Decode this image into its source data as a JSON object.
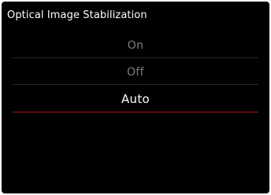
{
  "header": {
    "title": "Optical Image Stabilization"
  },
  "options": [
    {
      "label": "On"
    },
    {
      "label": "Off"
    },
    {
      "label": "Auto"
    }
  ],
  "selected": "Auto",
  "colors": {
    "background": "#000000",
    "text_primary": "#ffffff",
    "text_secondary": "#7d7d7d",
    "divider": "#262626",
    "accent": "#a3141d"
  }
}
